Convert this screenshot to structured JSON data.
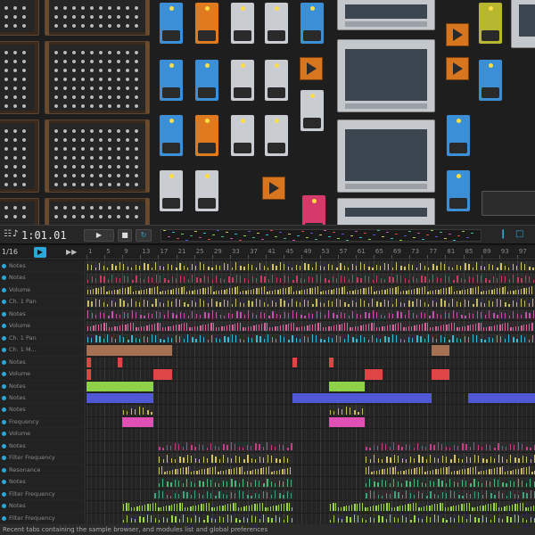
{
  "app": {
    "status_text": "Recent tabs containing the sample browser, and modules list and global preferences"
  },
  "transport": {
    "time": "1:01.01",
    "play_label": "▶",
    "stop_label": "■",
    "loop_label": "↻",
    "note_icon": "♪",
    "panel_icon": "❙",
    "folder_icon": "□"
  },
  "timeline": {
    "zoom": "1/16",
    "loop_label": "▶",
    "fwd_label": "▶▶",
    "ruler_ticks": [
      "1",
      "5",
      "9",
      "13",
      "17",
      "21",
      "25",
      "29",
      "33",
      "37",
      "41",
      "45",
      "49",
      "53",
      "57",
      "61",
      "65",
      "69",
      "73",
      "77",
      "81",
      "85",
      "89",
      "93",
      "97"
    ]
  },
  "tracks": [
    {
      "name": "Notes",
      "color": "#d4c25a"
    },
    {
      "name": "Notes",
      "color": "#c93a5f"
    },
    {
      "name": "Volume",
      "color": "#c8b95e"
    },
    {
      "name": "Ch. 1 Pan",
      "color": "#c8b95e"
    },
    {
      "name": "Notes",
      "color": "#c34fb0"
    },
    {
      "name": "Volume",
      "color": "#d7619b"
    },
    {
      "name": "Ch. 1 Pan",
      "color": "#2fbad6"
    },
    {
      "name": "Ch. 1 M...",
      "color": "#a57152"
    },
    {
      "name": "Notes",
      "color": "#e04545"
    },
    {
      "name": "Volume",
      "color": "#e04545"
    },
    {
      "name": "Notes",
      "color": "#8ed247"
    },
    {
      "name": "Notes",
      "color": "#5058d6"
    },
    {
      "name": "Notes",
      "color": "#c8b95e"
    },
    {
      "name": "Frequency",
      "color": "#e04fb4"
    },
    {
      "name": "Volume",
      "color": "#c34fb0"
    },
    {
      "name": "Notes",
      "color": "#c93a8b"
    },
    {
      "name": "Filter Frequency",
      "color": "#d4c25a"
    },
    {
      "name": "Resonance",
      "color": "#c8b95e"
    },
    {
      "name": "Notes",
      "color": "#46b873"
    },
    {
      "name": "Filter Frequency",
      "color": "#3fa27a"
    },
    {
      "name": "Notes",
      "color": "#9bd64a"
    },
    {
      "name": "Filter Frequency",
      "color": "#9bd64a"
    }
  ]
}
